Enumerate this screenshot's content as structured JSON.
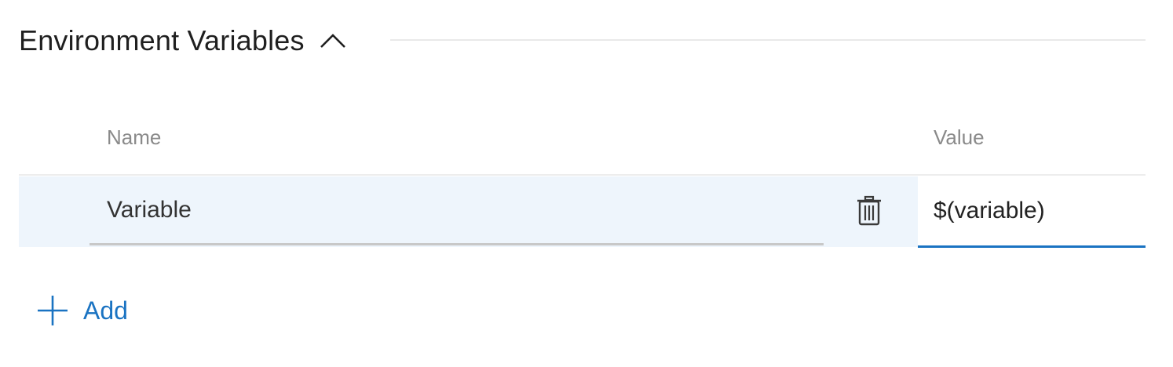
{
  "section": {
    "title": "Environment Variables",
    "toggle_icon": "chevron-up-icon"
  },
  "table": {
    "columns": [
      "Name",
      "Value"
    ],
    "rows": [
      {
        "name": "Variable",
        "value": "$(variable)",
        "delete_icon": "trash-icon"
      }
    ]
  },
  "add_button": {
    "label": "Add",
    "icon": "plus-icon"
  },
  "colors": {
    "accent": "#1a73c2",
    "row_highlight": "#eef5fc",
    "header_text": "#8a8a8a"
  }
}
